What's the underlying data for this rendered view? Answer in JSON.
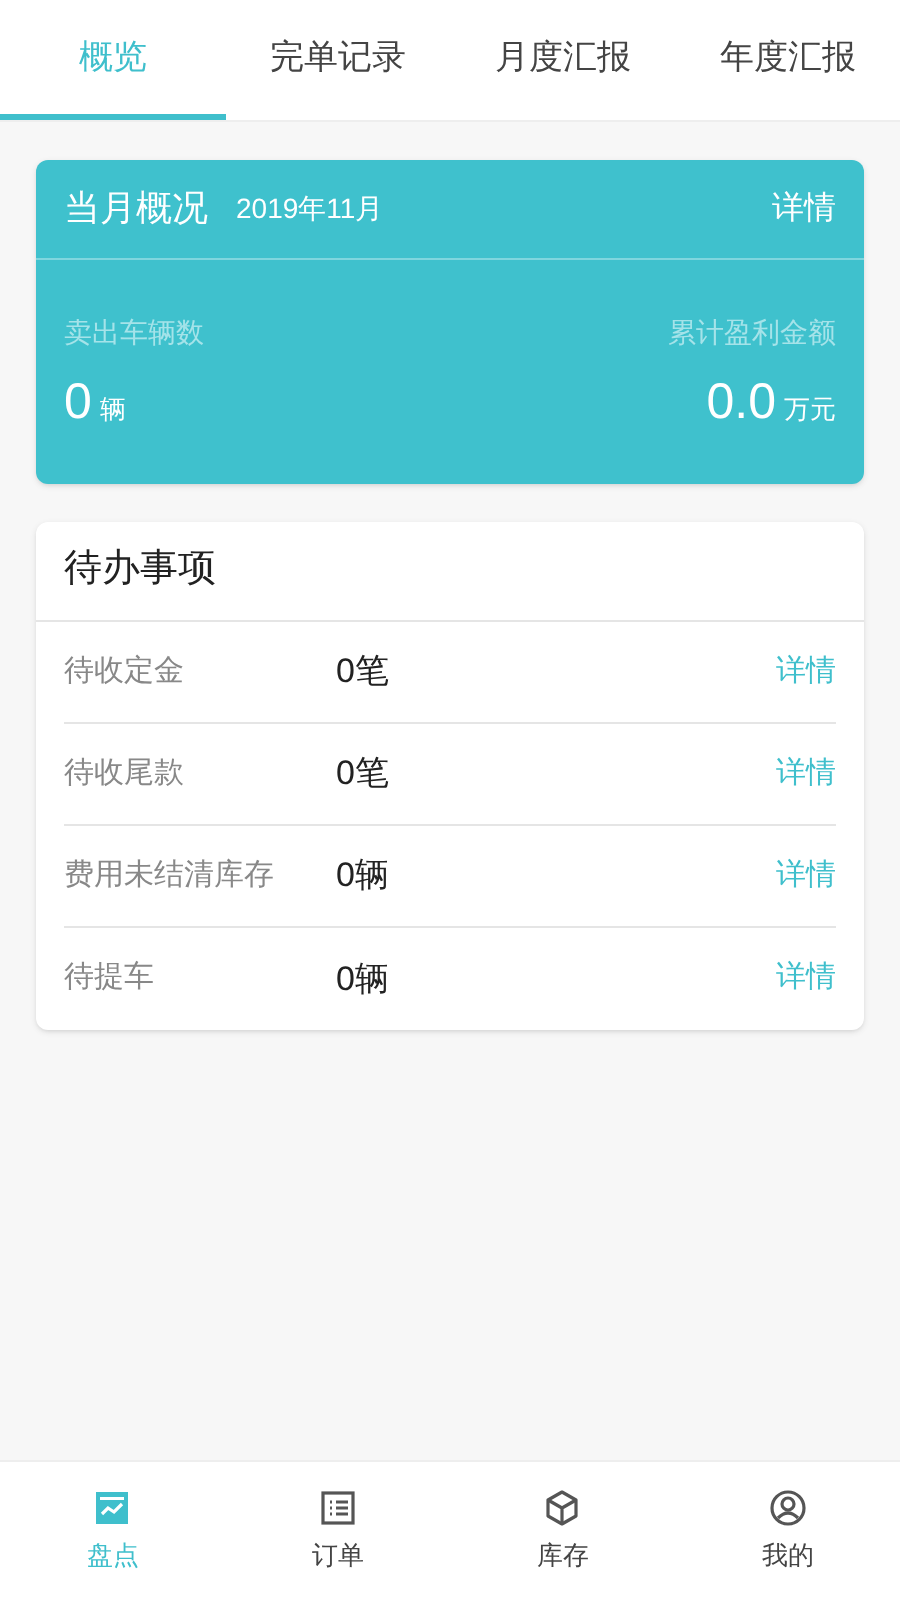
{
  "tabs": [
    {
      "label": "概览",
      "selected": true
    },
    {
      "label": "完单记录",
      "selected": false
    },
    {
      "label": "月度汇报",
      "selected": false
    },
    {
      "label": "年度汇报",
      "selected": false
    }
  ],
  "summary": {
    "title": "当月概况",
    "month": "2019年11月",
    "link": "详情",
    "stats": [
      {
        "label": "卖出车辆数",
        "value": "0",
        "unit": "辆"
      },
      {
        "label": "累计盈利金额",
        "value": "0.0",
        "unit": "万元"
      }
    ]
  },
  "todo": {
    "title": "待办事项",
    "rows": [
      {
        "label": "待收定金",
        "value": "0笔",
        "link": "详情"
      },
      {
        "label": "待收尾款",
        "value": "0笔",
        "link": "详情"
      },
      {
        "label": "费用未结清库存",
        "value": "0辆",
        "link": "详情"
      },
      {
        "label": "待提车",
        "value": "0辆",
        "link": "详情"
      }
    ]
  },
  "nav": [
    {
      "label": "盘点",
      "kind": "chart",
      "selected": true
    },
    {
      "label": "订单",
      "kind": "list",
      "selected": false
    },
    {
      "label": "库存",
      "kind": "box",
      "selected": false
    },
    {
      "label": "我的",
      "kind": "user",
      "selected": false
    }
  ]
}
